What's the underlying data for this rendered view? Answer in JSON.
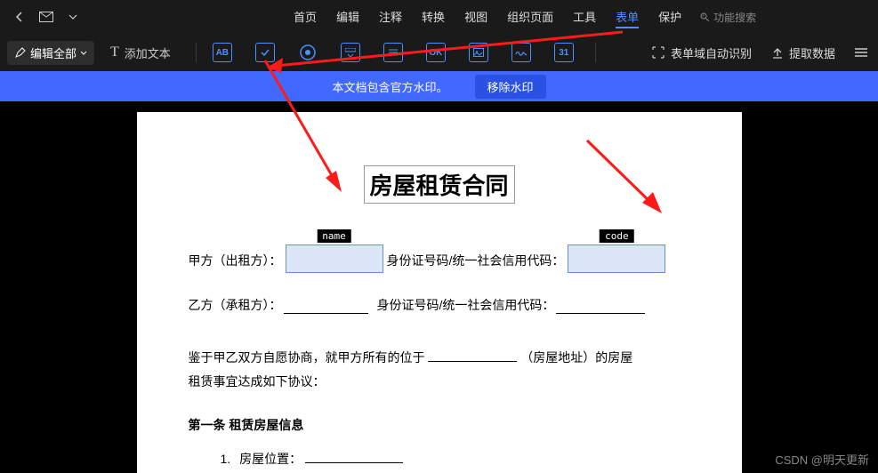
{
  "titlebar": {
    "back_icon": "back",
    "mail_icon": "mail",
    "chevron_icon": "chevron-down"
  },
  "main_tabs": [
    "首页",
    "编辑",
    "注释",
    "转换",
    "视图",
    "组织页面",
    "工具",
    "表单",
    "保护"
  ],
  "active_tab_index": 7,
  "func_search": "功能搜索",
  "toolbar": {
    "edit_all": "编辑全部",
    "add_text": "添加文本",
    "tool_ab": "AB",
    "tool_ok": "OK",
    "tool_date": "31",
    "auto_detect": "表单域自动识别",
    "extract": "提取数据"
  },
  "banner": {
    "text": "本文档包含官方水印。",
    "remove": "移除水印"
  },
  "document": {
    "title": "房屋租赁合同",
    "party_a_prefix": "甲方（出租方）：",
    "party_b_prefix": "乙方（承租方）：",
    "id_label": "身份证号码/统一社会信用代码：",
    "field_name": "name",
    "field_code": "code",
    "para1_a": "鉴于甲乙双方自愿协商，就甲方所有的位于",
    "para1_b": "（房屋地址）的房屋",
    "para2": "租赁事宜达成如下协议：",
    "section1": "第一条  租赁房屋信息",
    "list1_prefix": "1.",
    "list1_label": "房屋位置："
  },
  "watermark": "CSDN @明天更新"
}
